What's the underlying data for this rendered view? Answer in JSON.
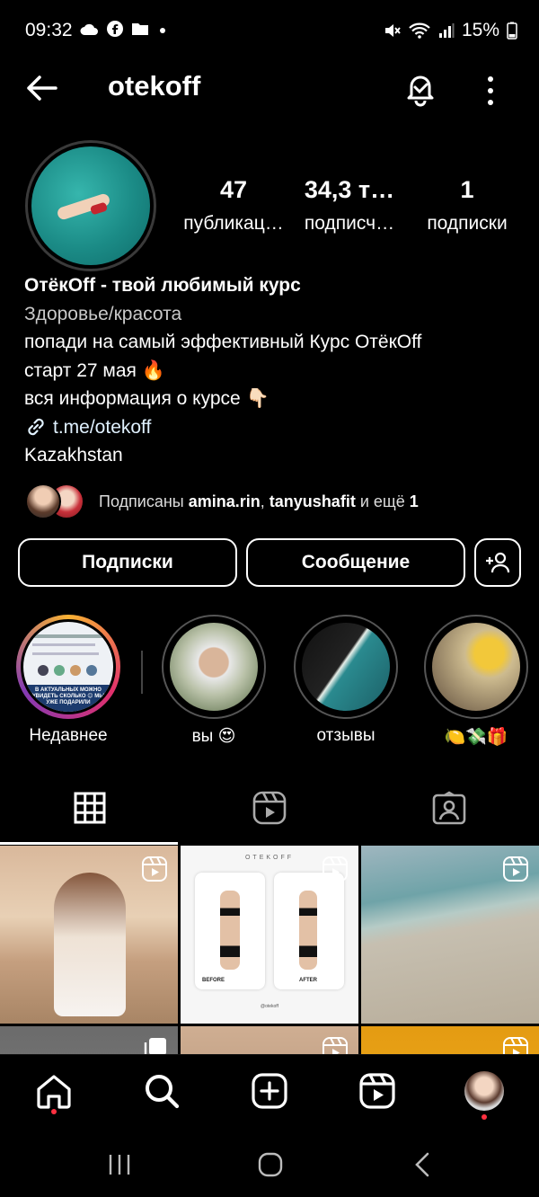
{
  "status_bar": {
    "time": "09:32",
    "battery": "15%",
    "icons": [
      "cloud-icon",
      "facebook-icon",
      "folder-icon",
      "dot-icon",
      "mute-icon",
      "wifi-icon",
      "signal-icon",
      "battery-icon"
    ]
  },
  "header": {
    "username": "otekoff"
  },
  "profile": {
    "stats": [
      {
        "value": "47",
        "label": "публикац…"
      },
      {
        "value": "34,3 т…",
        "label": "подписч…"
      },
      {
        "value": "1",
        "label": "подписки"
      }
    ],
    "bio": {
      "name": "ОтёкOff - твой любимый курс",
      "category": "Здоровье/красота",
      "lines": [
        "попади на самый эффективный Курс ОтёкOff",
        "старт 27 мая 🔥",
        "вся информация о курсе 👇🏻"
      ],
      "link": "t.me/otekoff",
      "location": "Kazakhstan"
    },
    "followed_by": {
      "prefix": "Подписаны ",
      "user1": "amina.rin",
      "comma": ", ",
      "user2": "tanyushafit",
      "suffix": " и ещё ",
      "count": "1"
    }
  },
  "buttons": {
    "following": "Подписки",
    "message": "Сообщение"
  },
  "highlights": [
    {
      "label": "Недавнее"
    },
    {
      "label": "вы 😍"
    },
    {
      "label": "отзывы"
    },
    {
      "label": "🍋💸🎁"
    }
  ],
  "highlight_story_text": "В АКТУАЛЬНЫХ МОЖНО УВИДЕТЬ СКОЛЬКО 😊 МЫ УЖЕ ПОДАРИЛИ",
  "posts": [
    {
      "type": "reel"
    },
    {
      "type": "reel",
      "title": "OTEKOFF",
      "before": "BEFORE",
      "after": "AFTER",
      "handle": "@otekoff"
    },
    {
      "type": "reel"
    },
    {
      "type": "carousel"
    },
    {
      "type": "reel"
    },
    {
      "type": "reel"
    }
  ],
  "colors": {
    "background": "#000000",
    "text": "#ffffff",
    "notification_dot": "#ff3040",
    "story_ring": [
      "#f9b233",
      "#e1306c",
      "#833ab4"
    ]
  }
}
